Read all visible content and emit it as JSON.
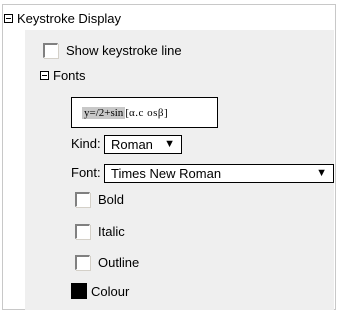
{
  "section": {
    "title": "Keystroke Display"
  },
  "options": {
    "show_keystroke_line": "Show keystroke line"
  },
  "fonts": {
    "title": "Fonts",
    "preview": {
      "selected": "y=/2+sin",
      "bracket_open": "[",
      "rest": "α.c  osβ",
      "bracket_close": "]"
    },
    "kind": {
      "label": "Kind:",
      "value": "Roman"
    },
    "font": {
      "label": "Font:",
      "value": "Times New Roman"
    },
    "bold": "Bold",
    "italic": "Italic",
    "outline": "Outline",
    "colour": "Colour"
  },
  "colors": {
    "colour_swatch": "#000000",
    "panel_bg": "#efefef"
  },
  "icons": {
    "expand": "minus-box-icon",
    "dropdown": "triangle-down-icon"
  }
}
